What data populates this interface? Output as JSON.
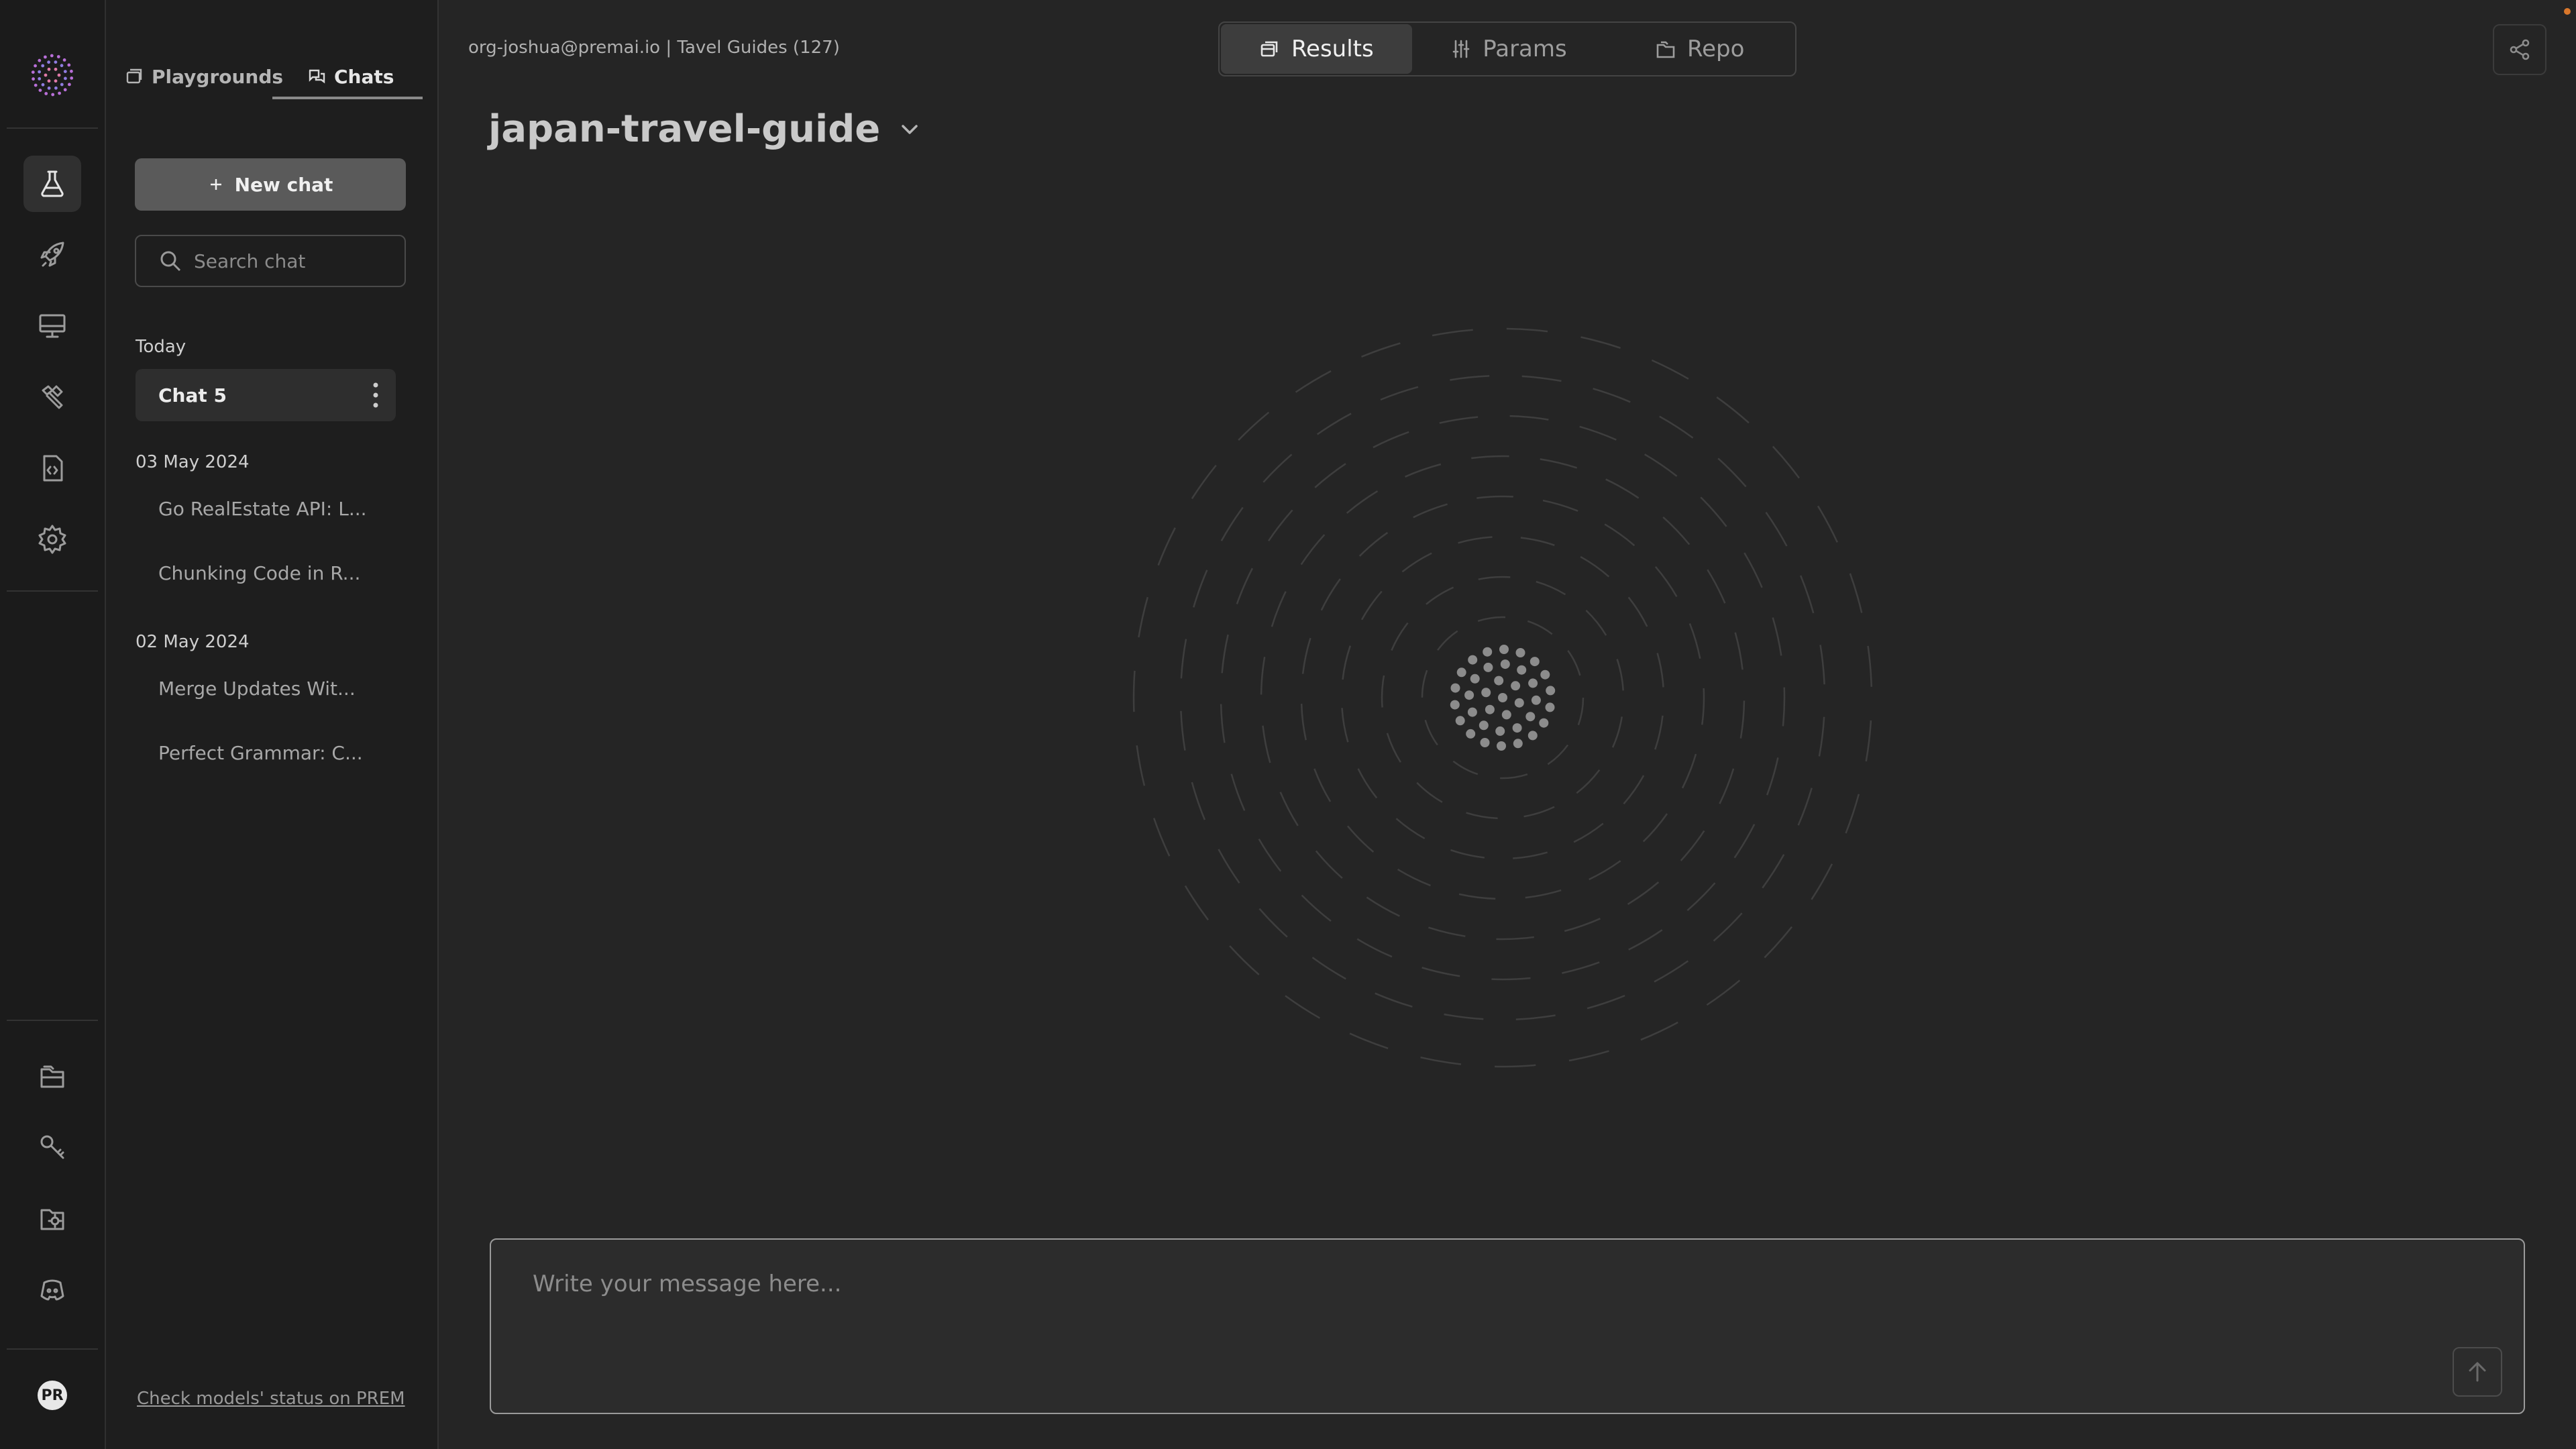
{
  "rail": {
    "top_items": [
      {
        "icon": "flask-icon",
        "active": true
      },
      {
        "icon": "rocket-icon",
        "active": false
      },
      {
        "icon": "monitor-icon",
        "active": false
      },
      {
        "icon": "tools-icon",
        "active": false
      },
      {
        "icon": "code-file-icon",
        "active": false
      },
      {
        "icon": "settings-icon",
        "active": false
      }
    ],
    "bottom_items": [
      {
        "icon": "folders-icon"
      },
      {
        "icon": "key-icon"
      },
      {
        "icon": "gear-folder-icon"
      },
      {
        "icon": "discord-icon"
      }
    ],
    "avatar_initials": "PR"
  },
  "panel": {
    "tabs": [
      {
        "label": "Playgrounds",
        "icon": "window-icon",
        "active": false
      },
      {
        "label": "Chats",
        "icon": "chat-bubbles-icon",
        "active": true
      }
    ],
    "new_chat_label": "New chat",
    "search_placeholder": "Search chat",
    "groups": [
      {
        "label": "Today",
        "chats": [
          "Chat 5"
        ]
      },
      {
        "label": "03 May 2024",
        "chats": [
          "Go RealEstate API: L...",
          "Chunking Code in R..."
        ]
      },
      {
        "label": "02 May 2024",
        "chats": [
          "Merge Updates Wit...",
          "Perfect Grammar: C..."
        ]
      }
    ],
    "status_link": "Check models' status on PREM"
  },
  "header": {
    "breadcrumb": "org-joshua@premai.io | Tavel Guides (127)",
    "segments": [
      {
        "label": "Results",
        "icon": "results-icon",
        "active": true
      },
      {
        "label": "Params",
        "icon": "sliders-icon",
        "active": false
      },
      {
        "label": "Repo",
        "icon": "repo-icon",
        "active": false
      }
    ],
    "share_icon": "share-icon"
  },
  "main": {
    "title": "japan-travel-guide",
    "composer_placeholder": "Write your message here..."
  },
  "colors": {
    "background": "#252525",
    "rail": "#1b1b1b",
    "panel": "#1e1e1e",
    "accent_dot": "#d9772b"
  }
}
